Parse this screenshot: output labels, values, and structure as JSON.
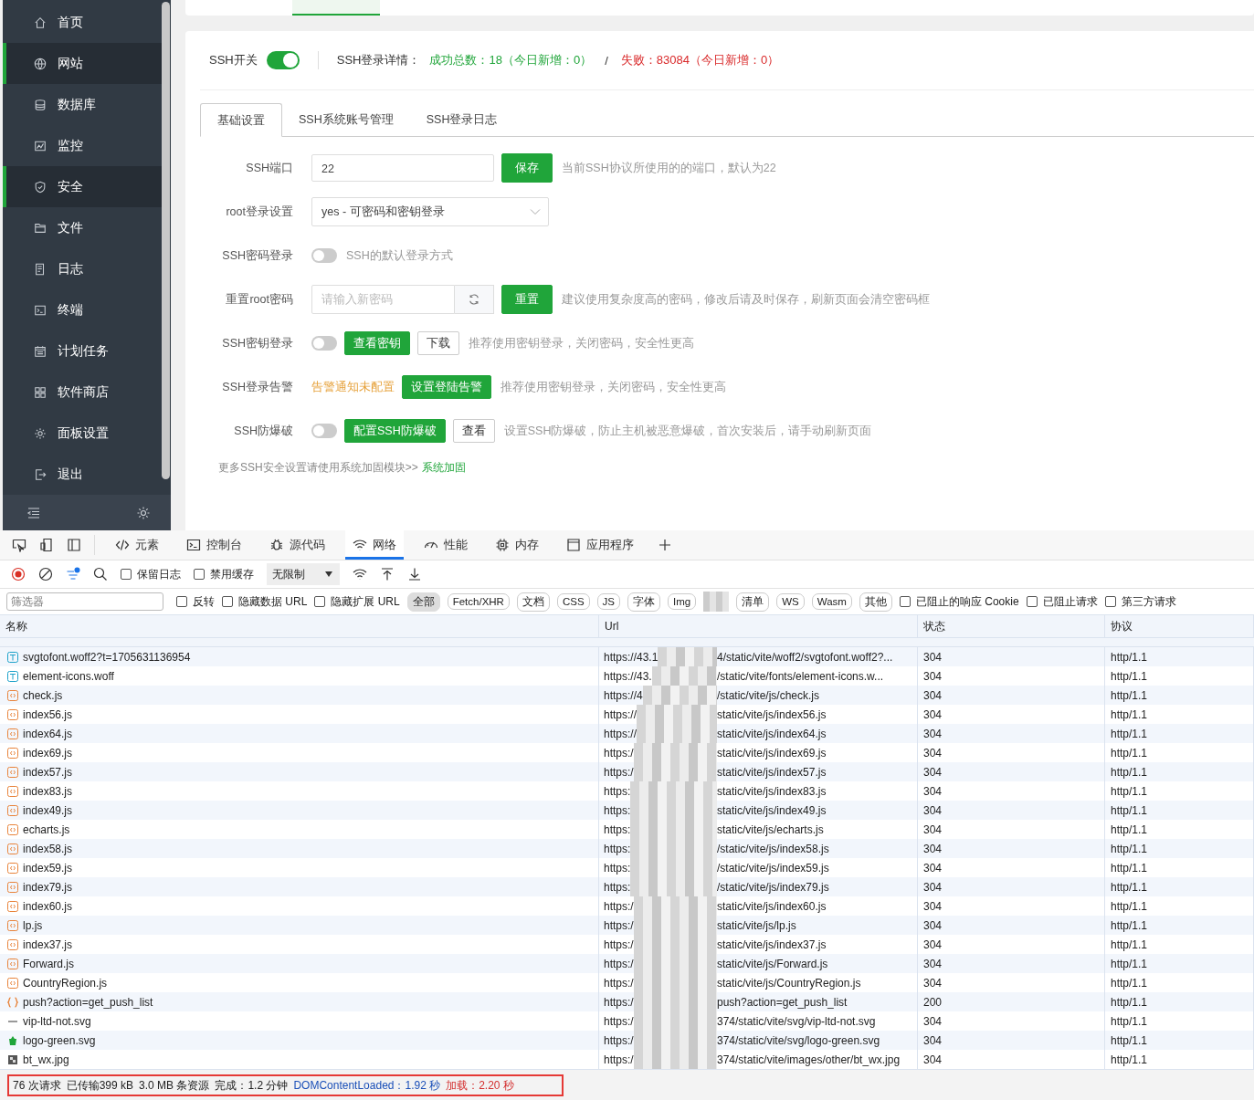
{
  "sidebar": {
    "items": [
      {
        "label": "首页",
        "selected": false
      },
      {
        "label": "网站",
        "selected": true
      },
      {
        "label": "数据库",
        "selected": false
      },
      {
        "label": "监控",
        "selected": false
      },
      {
        "label": "安全",
        "selected": true
      },
      {
        "label": "文件",
        "selected": false
      },
      {
        "label": "日志",
        "selected": false
      },
      {
        "label": "终端",
        "selected": false
      },
      {
        "label": "计划任务",
        "selected": false
      },
      {
        "label": "软件商店",
        "selected": false
      },
      {
        "label": "面板设置",
        "selected": false
      },
      {
        "label": "退出",
        "selected": false
      }
    ]
  },
  "ssh_header": {
    "switch_label": "SSH开关",
    "switch_on": true,
    "details_label": "SSH登录详情：",
    "success": "成功总数：18（今日新增：0）",
    "separator": "/",
    "failure": "失败：83084（今日新增：0）"
  },
  "tabs": [
    {
      "label": "基础设置",
      "selected": true
    },
    {
      "label": "SSH系统账号管理",
      "selected": false
    },
    {
      "label": "SSH登录日志",
      "selected": false
    }
  ],
  "settings": [
    {
      "label": "SSH端口",
      "controls": [
        {
          "kind": "input",
          "value": "22"
        },
        {
          "kind": "button",
          "label": "保存",
          "primary": true
        }
      ],
      "hint": "当前SSH协议所使用的的端口，默认为22"
    },
    {
      "label": "root登录设置",
      "controls": [
        {
          "kind": "select",
          "value": "yes - 可密码和密钥登录"
        }
      ]
    },
    {
      "label": "SSH密码登录",
      "controls": [
        {
          "kind": "toggle",
          "on": false
        }
      ],
      "hint": "SSH的默认登录方式"
    },
    {
      "label": "重置root密码",
      "controls": [
        {
          "kind": "password",
          "placeholder": "请输入新密码"
        },
        {
          "kind": "button",
          "label": "重置",
          "primary": true
        }
      ],
      "hint": "建议使用复杂度高的密码，修改后请及时保存，刷新页面会清空密码框"
    },
    {
      "label": "SSH密钥登录",
      "controls": [
        {
          "kind": "toggle",
          "on": false
        },
        {
          "kind": "button",
          "label": "查看密钥",
          "primary": true
        },
        {
          "kind": "button",
          "label": "下载",
          "primary": false
        }
      ],
      "hint": "推荐使用密钥登录，关闭密码，安全性更高"
    },
    {
      "label": "SSH登录告警",
      "controls": [
        {
          "kind": "warning",
          "text": "告警通知未配置"
        },
        {
          "kind": "button",
          "label": "设置登陆告警",
          "primary": true
        }
      ],
      "hint": "推荐使用密钥登录，关闭密码，安全性更高"
    },
    {
      "label": "SSH防爆破",
      "controls": [
        {
          "kind": "toggle",
          "on": false
        },
        {
          "kind": "button",
          "label": "配置SSH防爆破",
          "primary": true
        },
        {
          "kind": "button",
          "label": "查看",
          "primary": false
        }
      ],
      "hint": "设置SSH防爆破，防止主机被恶意爆破，首次安装后，请手动刷新页面"
    }
  ],
  "footer_note": {
    "text": "更多SSH安全设置请使用系统加固模块>>",
    "link": "系统加固"
  },
  "devtools": {
    "tabs": [
      {
        "label": "元素",
        "selected": false
      },
      {
        "label": "控制台",
        "selected": false
      },
      {
        "label": "源代码",
        "selected": false
      },
      {
        "label": "网络",
        "selected": true
      },
      {
        "label": "性能",
        "selected": false
      },
      {
        "label": "内存",
        "selected": false
      },
      {
        "label": "应用程序",
        "selected": false
      }
    ],
    "preserve_log": {
      "label": "保留日志",
      "checked": false
    },
    "disable_cache": {
      "label": "禁用缓存",
      "checked": false
    },
    "throttle": "无限制",
    "filter_placeholder": "筛选器",
    "filter_checks": [
      {
        "label": "反转",
        "checked": false
      },
      {
        "label": "隐藏数据 URL",
        "checked": false
      },
      {
        "label": "隐藏扩展 URL",
        "checked": false
      }
    ],
    "type_chips": [
      {
        "label": "全部",
        "selected": true
      },
      {
        "label": "Fetch/XHR",
        "selected": false
      },
      {
        "label": "文档",
        "selected": false
      },
      {
        "label": "CSS",
        "selected": false
      },
      {
        "label": "JS",
        "selected": false
      },
      {
        "label": "字体",
        "selected": false
      },
      {
        "label": "Img",
        "selected": false
      },
      {
        "label": "清单",
        "selected": false
      },
      {
        "label": "WS",
        "selected": false
      },
      {
        "label": "Wasm",
        "selected": false
      },
      {
        "label": "其他",
        "selected": false
      }
    ],
    "extra_checks": [
      {
        "label": "已阻止的响应 Cookie",
        "checked": false
      },
      {
        "label": "已阻止请求",
        "checked": false
      },
      {
        "label": "第三方请求",
        "checked": false
      }
    ],
    "columns": [
      "名称",
      "Url",
      "状态",
      "协议"
    ],
    "rows": [
      {
        "kind": "font",
        "name": "svgtofont.woff2?t=1705631136954",
        "url_start": "https://43.1",
        "url_end": "4/static/vite/woff2/svgtofont.woff2?...",
        "status": "304",
        "protocol": "http/1.1"
      },
      {
        "kind": "font",
        "name": "element-icons.woff",
        "url_start": "https://43.",
        "url_end": "/static/vite/fonts/element-icons.w...",
        "status": "304",
        "protocol": "http/1.1"
      },
      {
        "kind": "script",
        "name": "check.js",
        "url_start": "https://4",
        "url_end": "/static/vite/js/check.js",
        "status": "304",
        "protocol": "http/1.1"
      },
      {
        "kind": "script",
        "name": "index56.js",
        "url_start": "https://",
        "url_end": "static/vite/js/index56.js",
        "status": "304",
        "protocol": "http/1.1"
      },
      {
        "kind": "script",
        "name": "index64.js",
        "url_start": "https://",
        "url_end": "static/vite/js/index64.js",
        "status": "304",
        "protocol": "http/1.1"
      },
      {
        "kind": "script",
        "name": "index69.js",
        "url_start": "https:/",
        "url_end": "static/vite/js/index69.js",
        "status": "304",
        "protocol": "http/1.1"
      },
      {
        "kind": "script",
        "name": "index57.js",
        "url_start": "https:/",
        "url_end": "static/vite/js/index57.js",
        "status": "304",
        "protocol": "http/1.1"
      },
      {
        "kind": "script",
        "name": "index83.js",
        "url_start": "https:",
        "url_end": "static/vite/js/index83.js",
        "status": "304",
        "protocol": "http/1.1"
      },
      {
        "kind": "script",
        "name": "index49.js",
        "url_start": "https:",
        "url_end": "static/vite/js/index49.js",
        "status": "304",
        "protocol": "http/1.1"
      },
      {
        "kind": "script",
        "name": "echarts.js",
        "url_start": "https:",
        "url_end": "static/vite/js/echarts.js",
        "status": "304",
        "protocol": "http/1.1"
      },
      {
        "kind": "script",
        "name": "index58.js",
        "url_start": "https:",
        "url_end": "/static/vite/js/index58.js",
        "status": "304",
        "protocol": "http/1.1"
      },
      {
        "kind": "script",
        "name": "index59.js",
        "url_start": "https:",
        "url_end": "/static/vite/js/index59.js",
        "status": "304",
        "protocol": "http/1.1"
      },
      {
        "kind": "script",
        "name": "index79.js",
        "url_start": "https:",
        "url_end": "/static/vite/js/index79.js",
        "status": "304",
        "protocol": "http/1.1"
      },
      {
        "kind": "script",
        "name": "index60.js",
        "url_start": "https:/",
        "url_end": "static/vite/js/index60.js",
        "status": "304",
        "protocol": "http/1.1"
      },
      {
        "kind": "script",
        "name": "lp.js",
        "url_start": "https:/",
        "url_end": "static/vite/js/lp.js",
        "status": "304",
        "protocol": "http/1.1"
      },
      {
        "kind": "script",
        "name": "index37.js",
        "url_start": "https:/",
        "url_end": "static/vite/js/index37.js",
        "status": "304",
        "protocol": "http/1.1"
      },
      {
        "kind": "script",
        "name": "Forward.js",
        "url_start": "https:/",
        "url_end": "static/vite/js/Forward.js",
        "status": "304",
        "protocol": "http/1.1"
      },
      {
        "kind": "script",
        "name": "CountryRegion.js",
        "url_start": "https:/",
        "url_end": "static/vite/js/CountryRegion.js",
        "status": "304",
        "protocol": "http/1.1"
      },
      {
        "kind": "fetch",
        "name": "push?action=get_push_list",
        "url_start": "https:/",
        "url_end": "push?action=get_push_list",
        "status": "200",
        "protocol": "http/1.1"
      },
      {
        "kind": "svg",
        "name": "vip-ltd-not.svg",
        "url_start": "https:/",
        "url_end": "374/static/vite/svg/vip-ltd-not.svg",
        "status": "304",
        "protocol": "http/1.1"
      },
      {
        "kind": "logo",
        "name": "logo-green.svg",
        "url_start": "https:/",
        "url_end": "374/static/vite/svg/logo-green.svg",
        "status": "304",
        "protocol": "http/1.1"
      },
      {
        "kind": "image",
        "name": "bt_wx.jpg",
        "url_start": "https:/",
        "url_end": "374/static/vite/images/other/bt_wx.jpg",
        "status": "304",
        "protocol": "http/1.1"
      }
    ],
    "summary": [
      {
        "kind": "plain",
        "text": "76 次请求"
      },
      {
        "kind": "plain",
        "text": "已传输399 kB"
      },
      {
        "kind": "plain",
        "text": "3.0 MB 条资源"
      },
      {
        "kind": "plain",
        "text": "完成：1.2 分钟"
      },
      {
        "kind": "dom",
        "text": "DOMContentLoaded：1.92 秒"
      },
      {
        "kind": "load",
        "text": "加载：2.20 秒"
      }
    ]
  }
}
